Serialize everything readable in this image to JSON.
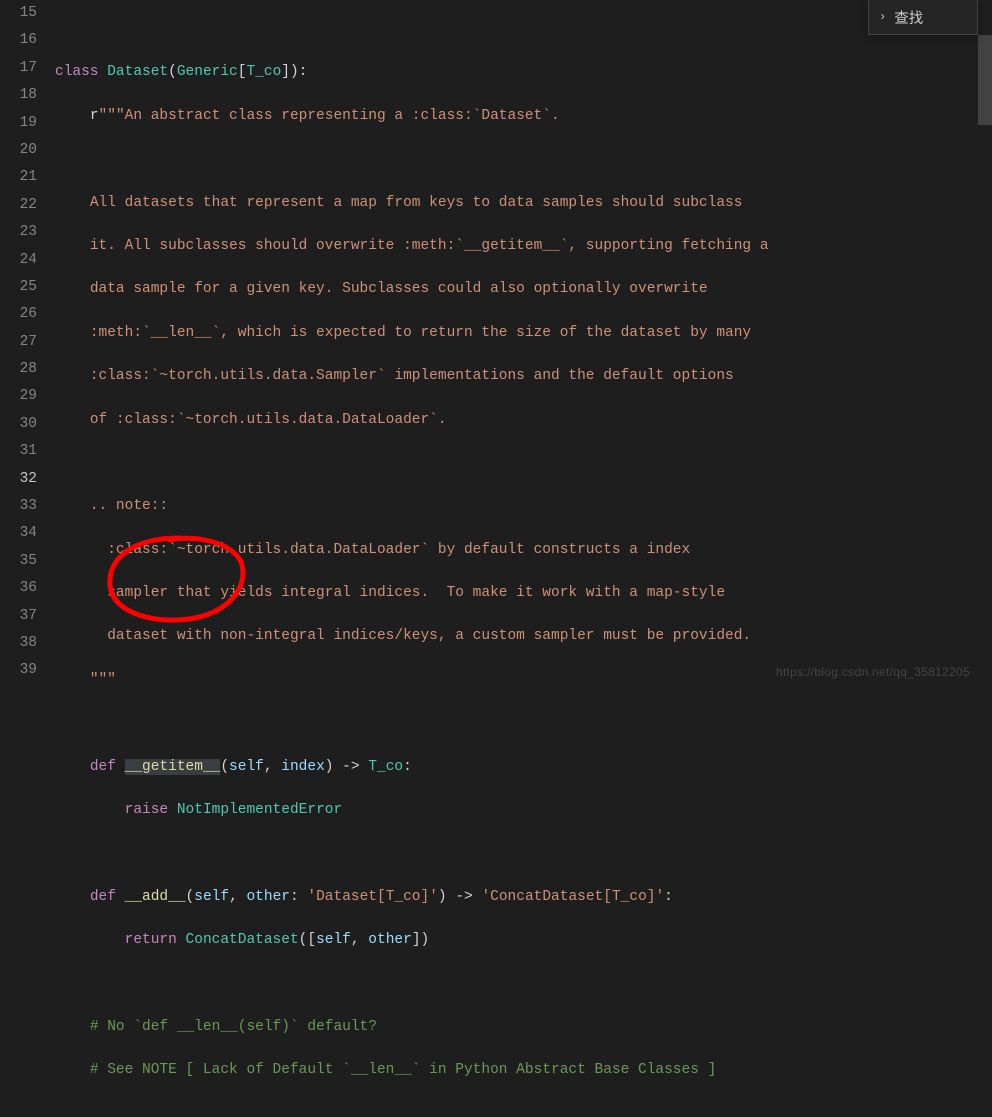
{
  "find": {
    "label": "查找"
  },
  "gutter": {
    "start": 15,
    "end": 39,
    "current": 32
  },
  "code": {
    "l15": "",
    "l16_class": "class",
    "l16_name": "Dataset",
    "l16_generic": "Generic",
    "l16_tco": "T_co",
    "l17_r": "r",
    "l17_q": "\"\"\"",
    "l17_txt": "An abstract class representing a :class:`Dataset`.",
    "l19_txt": "All datasets that represent a map from keys to data samples should subclass",
    "l20_txt": "it. All subclasses should overwrite :meth:`__getitem__`, supporting fetching a",
    "l21_txt": "data sample for a given key. Subclasses could also optionally overwrite",
    "l22_txt": ":meth:`__len__`, which is expected to return the size of the dataset by many",
    "l23_txt": ":class:`~torch.utils.data.Sampler` implementations and the default options",
    "l24_txt": "of :class:`~torch.utils.data.DataLoader`.",
    "l26_txt": ".. note::",
    "l27_txt": ":class:`~torch.utils.data.DataLoader` by default constructs a index",
    "l28_txt": "sampler that yields integral indices.  To make it work with a map-style",
    "l29_txt": "dataset with non-integral indices/keys, a custom sampler must be provided.",
    "l30_q": "\"\"\"",
    "l32_def": "def",
    "l32_name": "__getitem__",
    "l32_self": "self",
    "l32_idx": "index",
    "l32_ret": "T_co",
    "l33_raise": "raise",
    "l33_err": "NotImplementedError",
    "l35_def": "def",
    "l35_name": "__add__",
    "l35_self": "self",
    "l35_other": "other",
    "l35_t1": "'Dataset[T_co]'",
    "l35_t2": "'ConcatDataset[T_co]'",
    "l36_ret": "return",
    "l36_cls": "ConcatDataset",
    "l36_args": "([self, other])",
    "l36_self": "self",
    "l36_other": "other",
    "l38_txt": "# No `def __len__(self)` default?",
    "l39_txt": "# See NOTE [ Lack of Default `__len__` in Python Abstract Base Classes ]"
  },
  "watermark": "https://blog.csdn.net/qq_35812205"
}
